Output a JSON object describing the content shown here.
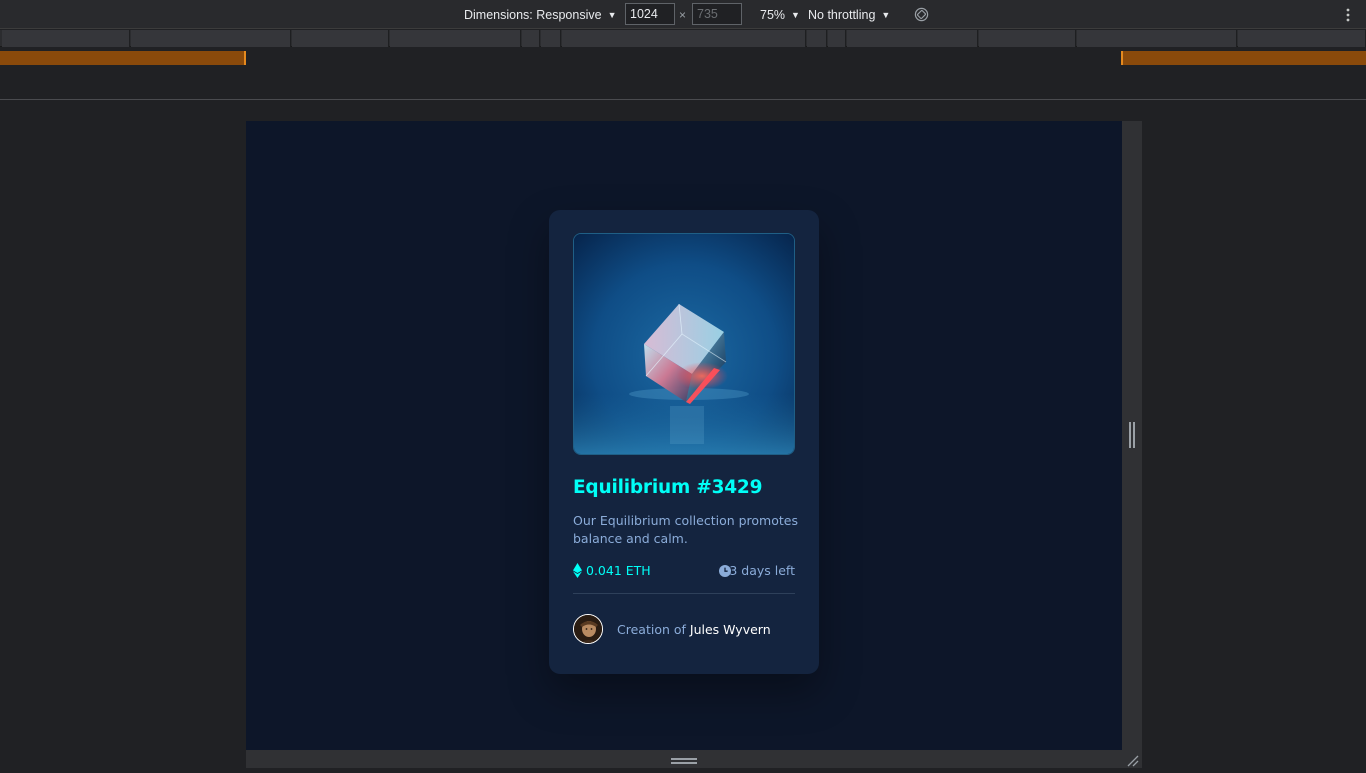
{
  "devtools": {
    "dimensions_label": "Dimensions: Responsive",
    "width_value": "1024",
    "height_placeholder": "735",
    "times_sign": "×",
    "zoom_label": "75%",
    "throttling_label": "No throttling",
    "icons": [
      "caret-down-icon",
      "rotate-icon",
      "more-vert-icon"
    ]
  },
  "card": {
    "title": "Equilibrium #3429",
    "description": "Our Equilibrium collection promotes balance and calm.",
    "price": "0.041 ETH",
    "time_left": "3 days left",
    "creator_lead": "Creation of",
    "creator_name": "Jules Wyvern",
    "image_alt_icon": "crystal-cube-image",
    "colors": {
      "page_bg": "#0d1629",
      "card_bg": "#14243f",
      "cyan": "#00fff7",
      "soft_blue": "#8bacd9",
      "white": "#ffffff"
    }
  }
}
